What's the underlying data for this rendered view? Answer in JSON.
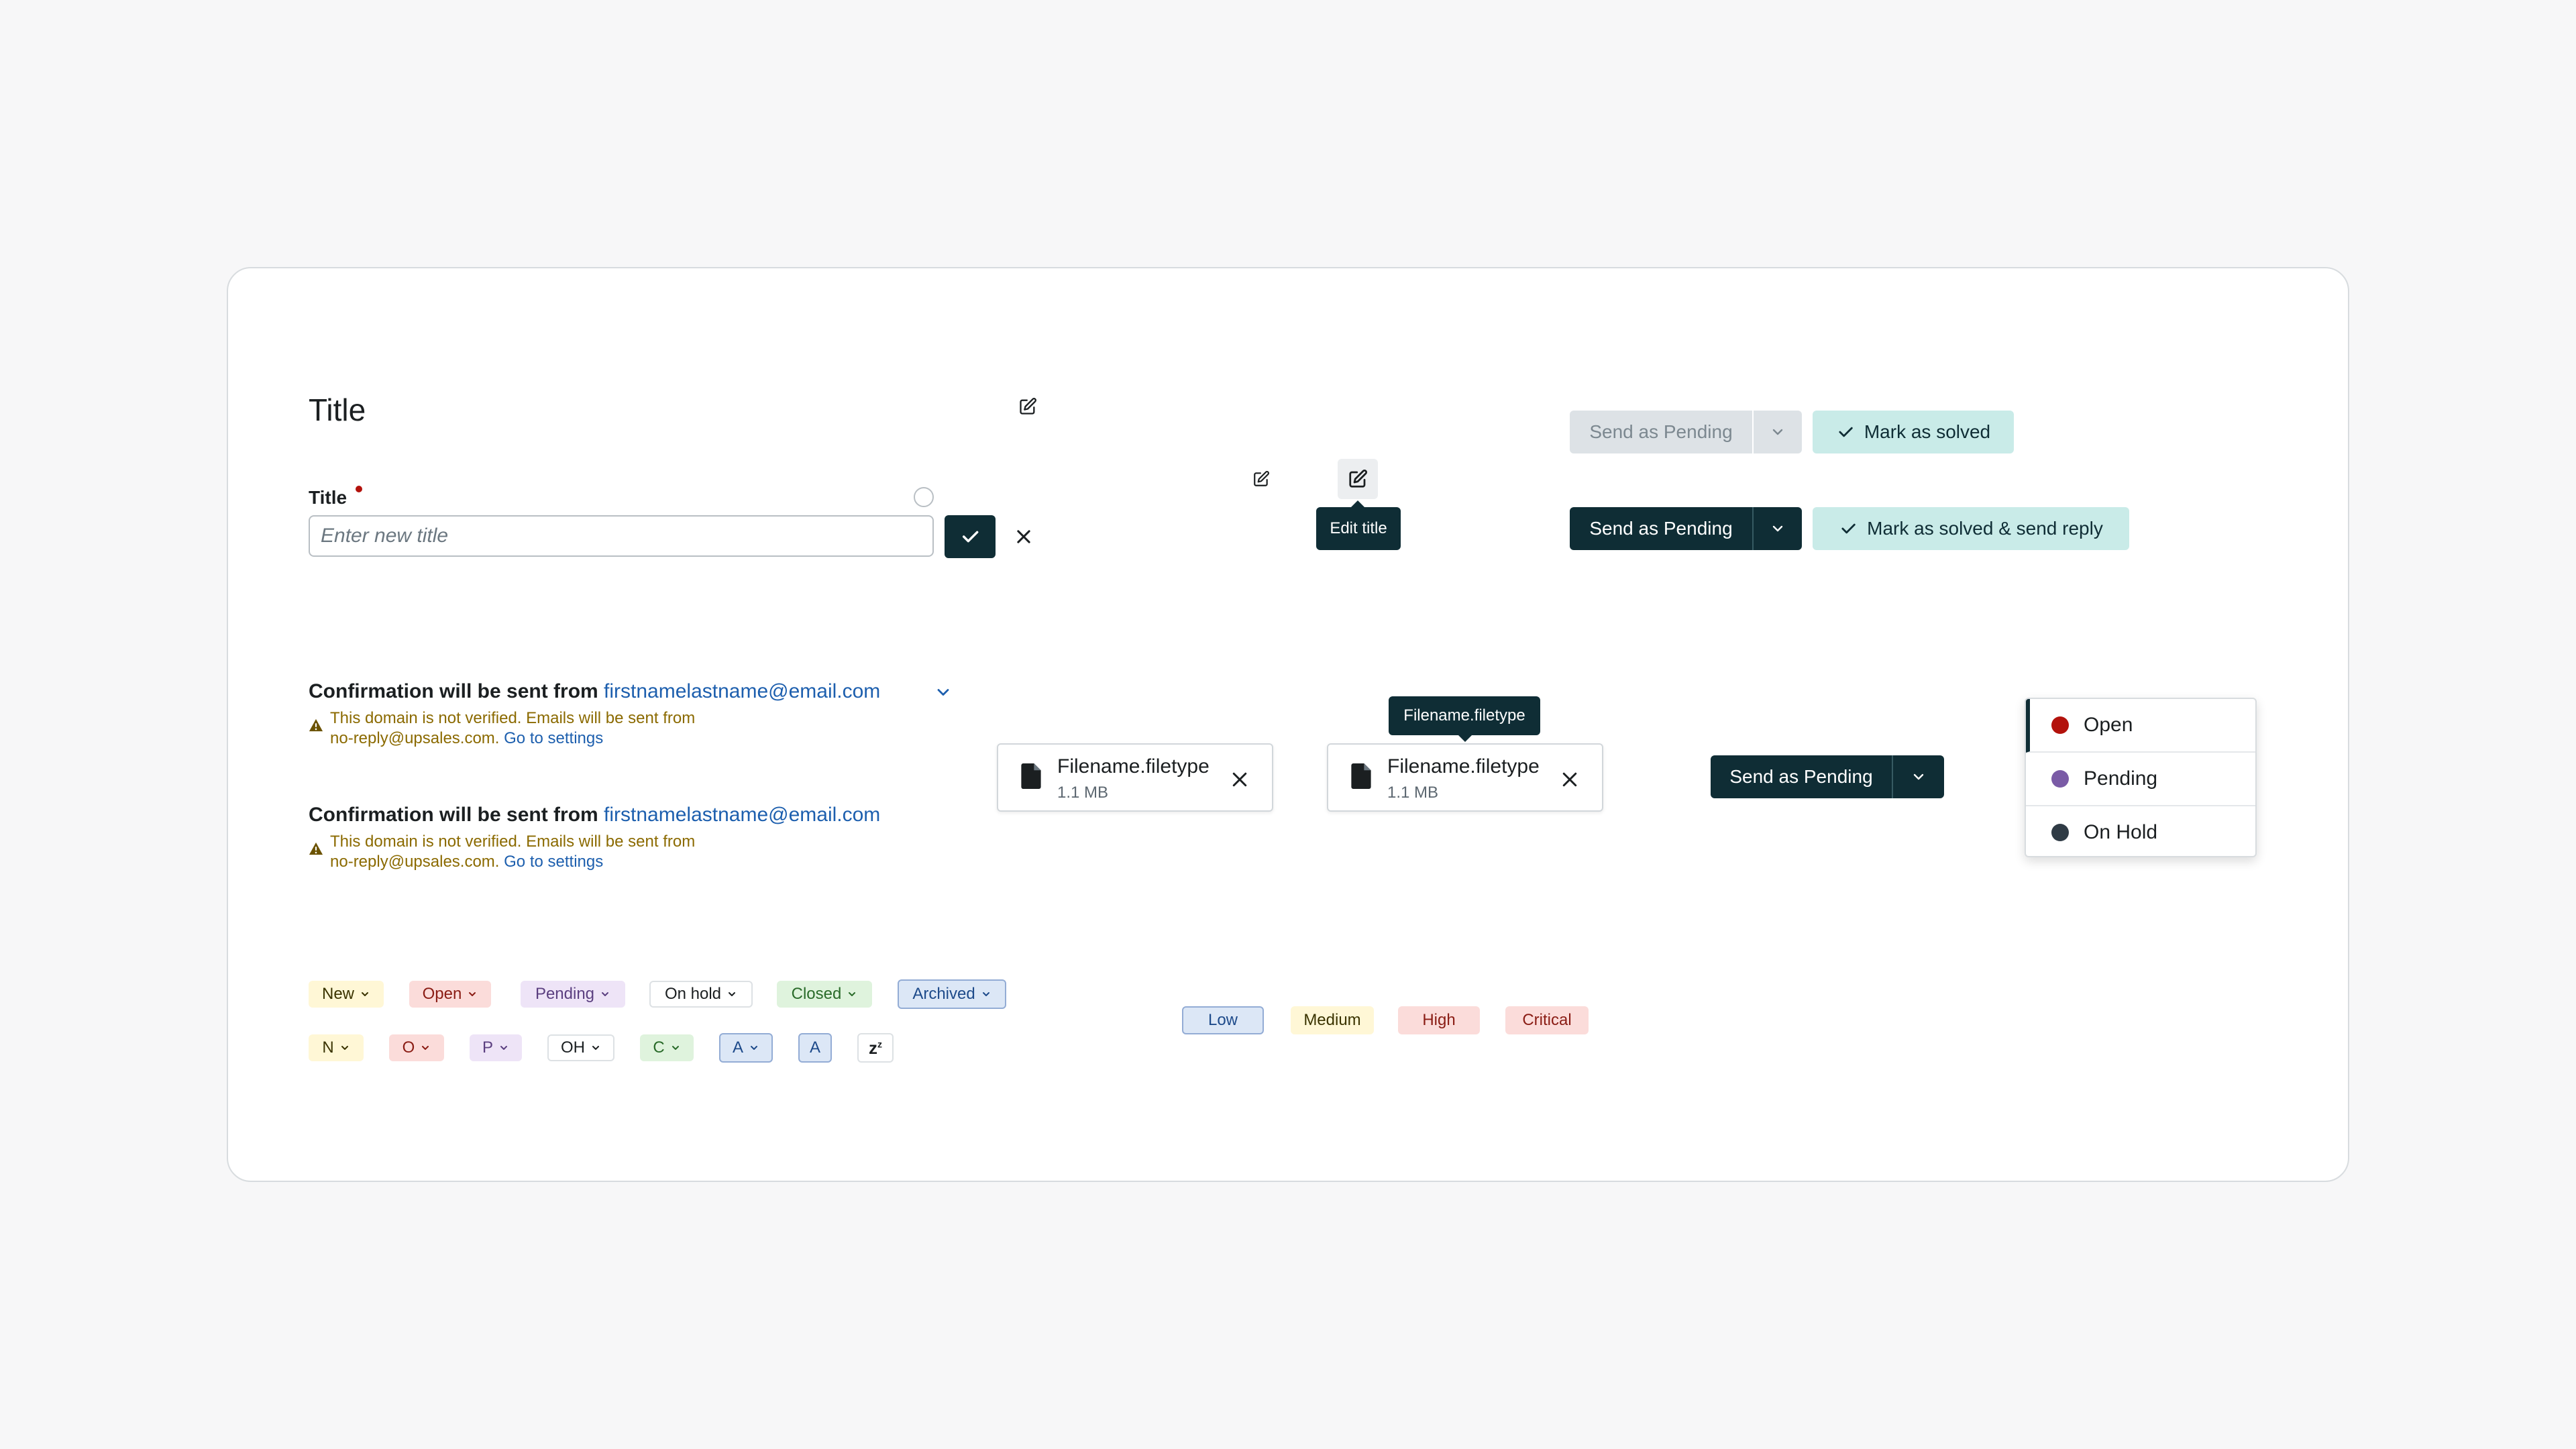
{
  "title_section": {
    "heading": "Title",
    "field_label": "Title",
    "input_placeholder": "Enter new title",
    "tooltip": "Edit title"
  },
  "send_buttons": {
    "disabled_send": "Send as Pending",
    "mark_solved": "Mark as solved",
    "send_pending": "Send as Pending",
    "mark_solved_reply": "Mark as solved & send reply",
    "send_pending_2": "Send as Pending"
  },
  "confirmations": [
    {
      "lead": "Confirmation will be sent from",
      "email": "firstnamelastname@email.com",
      "warning_line1": "This domain is not verified. Emails will be sent from",
      "warning_line2": "no-reply@upsales.com.",
      "link": "Go to settings"
    },
    {
      "lead": "Confirmation will be sent from",
      "email": "firstnamelastname@email.com",
      "warning_line1": "This domain is not verified. Emails will be sent from",
      "warning_line2": "no-reply@upsales.com.",
      "link": "Go to settings"
    }
  ],
  "files": [
    {
      "name": "Filename.filetype",
      "size": "1.1 MB"
    },
    {
      "name": "Filename.filetype",
      "size": "1.1 MB",
      "tooltip": "Filename.filetype"
    }
  ],
  "status_menu": {
    "items": [
      {
        "label": "Open",
        "color": "#b3120c"
      },
      {
        "label": "Pending",
        "color": "#7a5ba6"
      },
      {
        "label": "On Hold",
        "color": "#2f3b45"
      }
    ]
  },
  "status_chips": [
    "New",
    "Open",
    "Pending",
    "On hold",
    "Closed",
    "Archived"
  ],
  "status_chips_short": [
    "N",
    "O",
    "P",
    "OH",
    "C",
    "A",
    "A",
    "z"
  ],
  "priority_chips": [
    "Low",
    "Medium",
    "High",
    "Critical"
  ],
  "colors": {
    "accent_dark": "#0f2d35",
    "mint": "#c9ebe8",
    "link": "#1d5fae",
    "warning": "#8b6a00"
  }
}
